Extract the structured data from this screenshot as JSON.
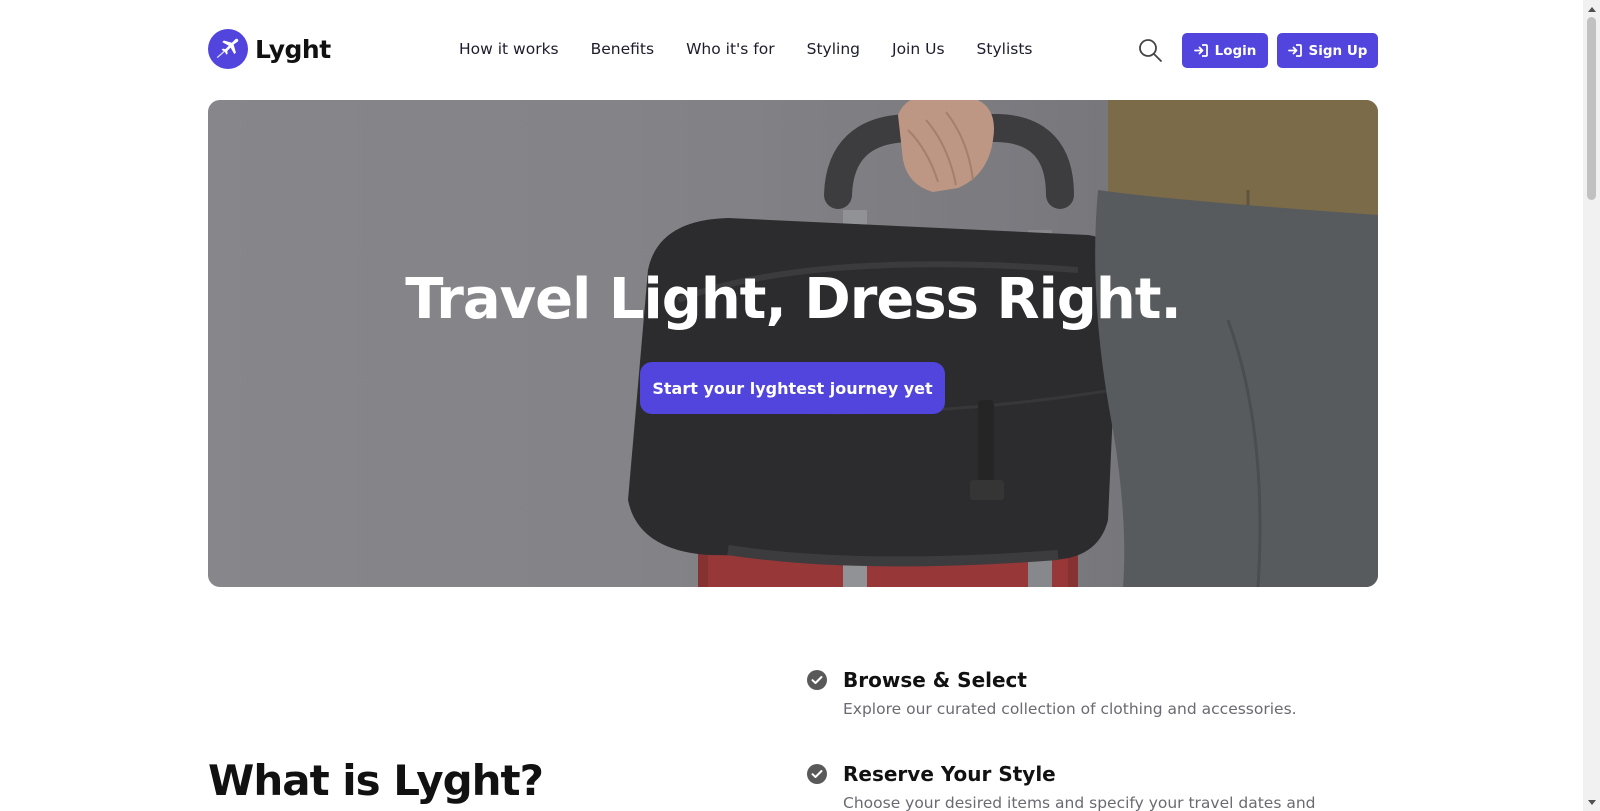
{
  "brand": {
    "name": "Lyght",
    "accent": "#5145dd"
  },
  "nav": {
    "items": [
      {
        "label": "How it works"
      },
      {
        "label": "Benefits"
      },
      {
        "label": "Who it's for"
      },
      {
        "label": "Styling"
      },
      {
        "label": "Join Us"
      },
      {
        "label": "Stylists"
      }
    ]
  },
  "header": {
    "search_icon": "search-icon",
    "login_label": "Login",
    "signup_label": "Sign Up"
  },
  "hero": {
    "title": "Travel Light, Dress Right.",
    "cta_label": "Start your lyghtest journey yet"
  },
  "about": {
    "title": "What is Lyght?"
  },
  "steps": [
    {
      "title": "Browse & Select",
      "description": "Explore our curated collection of clothing and accessories."
    },
    {
      "title": "Reserve Your Style",
      "description": "Choose your desired items and specify your travel dates and"
    }
  ]
}
